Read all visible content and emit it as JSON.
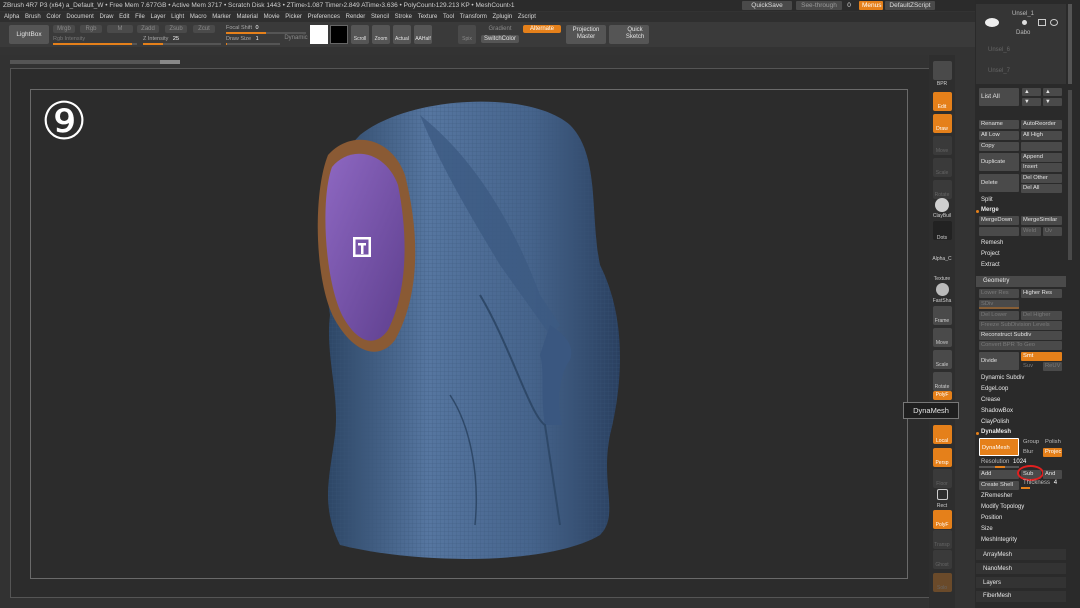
{
  "titlebar": {
    "text": "ZBrush 4R7 P3 (x64)    a_Default_W    • Free Mem 7.677GB • Active Mem 3717 • Scratch Disk 1443 • ZTime›1.087 Timer›2.849 ATime›3.636 • PolyCount›129.213 KP • MeshCount›1",
    "quicksave": "QuickSave",
    "seethrough": "See-through",
    "seethrough_value": "0",
    "menus": "Menus",
    "defaultzscript": "DefaultZScript"
  },
  "menubar": [
    "Alpha",
    "Brush",
    "Color",
    "Document",
    "Draw",
    "Edit",
    "File",
    "Layer",
    "Light",
    "Macro",
    "Marker",
    "Material",
    "Movie",
    "Picker",
    "Preferences",
    "Render",
    "Stencil",
    "Stroke",
    "Texture",
    "Tool",
    "Transform",
    "Zplugin",
    "Zscript"
  ],
  "toolbar": {
    "lightbox": "LightBox",
    "mrgb": "Mrgb",
    "rgb": "Rgb",
    "m": "M",
    "zadd": "Zadd",
    "zsub": "Zsub",
    "zcut": "Zcut",
    "rgb_intensity": "Rgb Intensity",
    "z_intensity_label": "Z Intensity",
    "z_intensity_value": "25",
    "focal_shift_label": "Focal Shift",
    "focal_shift_value": "0",
    "draw_size_label": "Draw Size",
    "draw_size_value": "1",
    "dynamic": "Dynamic",
    "tool_buttons": [
      "Scroll",
      "Zoom",
      "Actual",
      "AAHalf",
      "Spix"
    ],
    "gradient": "Gradient",
    "switchcolor": "SwitchColor",
    "alternate": "Alternate",
    "projection_master": "Projection Master",
    "quick_sketch": "Quick Sketch"
  },
  "canvas": {
    "step": "⑨"
  },
  "shelf": [
    {
      "label": "BPR"
    },
    {
      "label": "Edit"
    },
    {
      "label": "Draw"
    },
    {
      "label": "Move"
    },
    {
      "label": "Scale"
    },
    {
      "label": "Rotate"
    },
    {
      "label": "ClayBuil"
    },
    {
      "label": "Dots"
    },
    {
      "label": "Alpha_C"
    },
    {
      "label": "Texture"
    },
    {
      "label": "FastSha"
    },
    {
      "label": "Frame"
    },
    {
      "label": "Move"
    },
    {
      "label": "Scale"
    },
    {
      "label": "Rotate"
    },
    {
      "label": "PolyF"
    },
    {
      "label": "Local"
    },
    {
      "label": "Persp"
    },
    {
      "label": "Floor"
    },
    {
      "label": "Rect"
    },
    {
      "label": "PolyF"
    },
    {
      "label": "Transp"
    },
    {
      "label": "Ghost"
    },
    {
      "label": "Solo"
    }
  ],
  "tooltip": "DynaMesh",
  "palette": {
    "subtool_top": [
      "Unsel_1",
      "Dabo",
      "Unsel_6",
      "Unsel_7"
    ],
    "list_all": "List All",
    "rename": "Rename",
    "autoreorder": "AutoReorder",
    "all_low": "All Low",
    "all_high": "All High",
    "copy": "Copy",
    "duplicate": "Duplicate",
    "append": "Append",
    "insert": "Insert",
    "delete": "Delete",
    "del_other": "Del Other",
    "del_all": "Del All",
    "split": "Split",
    "merge": "Merge",
    "merge_down": "MergeDown",
    "merge_similar": "MergeSimilar",
    "weld": "Weld",
    "uv": "Uv",
    "remesh": "Remesh",
    "project": "Project",
    "extract": "Extract",
    "geometry": "Geometry",
    "lower_res": "Lower Res",
    "higher_res": "Higher Res",
    "sdiv": "SDiv",
    "del_lower": "Del Lower",
    "del_higher": "Del Higher",
    "freeze_subdiv": "Freeze SubDivision Levels",
    "reconstruct_subdiv": "Reconstruct Subdiv",
    "convert_bpr": "Convert BPR To Geo",
    "divide": "Divide",
    "smt": "Smt",
    "suv": "Suv",
    "reuv": "ReUV",
    "dynamic_subdiv": "Dynamic Subdiv",
    "edgeloop": "EdgeLoop",
    "crease": "Crease",
    "shadowbox": "ShadowBox",
    "claypolish": "ClayPolish",
    "dynamesh_section": "DynaMesh",
    "dynamesh_btn": "DynaMesh",
    "group": "Group",
    "polish": "Polish",
    "blur": "Blur",
    "project_btn": "Projec",
    "resolution_label": "Resolution",
    "resolution_value": "1024",
    "add": "Add",
    "sub": "Sub",
    "and": "And",
    "create_shell": "Create Shell",
    "thickness_label": "Thickness",
    "thickness_value": "4",
    "zremesher": "ZRemesher",
    "modify_topology": "Modify Topology",
    "position": "Position",
    "size": "Size",
    "meshintegrity": "MeshIntegrity",
    "arraymesh": "ArrayMesh",
    "nanomesh": "NanoMesh",
    "layers": "Layers",
    "fibermesh": "FiberMesh"
  },
  "colors": {
    "accent": "#e5801a",
    "highlight_circle": "#e02020",
    "mesh_blue": "#4a6a8f",
    "interior_purple": "#7a52a8"
  }
}
